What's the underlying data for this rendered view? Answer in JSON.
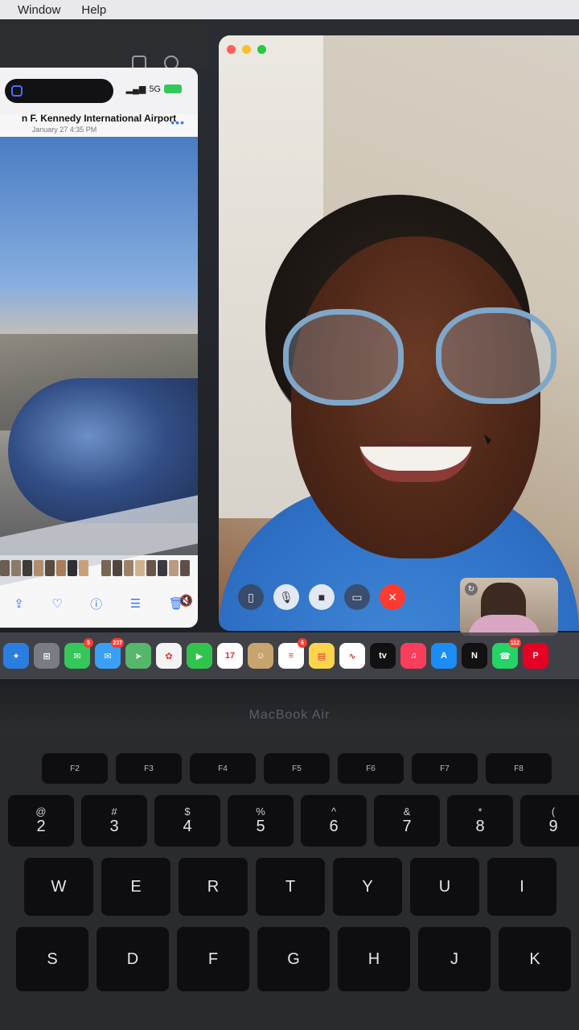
{
  "menubar": {
    "items": [
      "Window",
      "Help"
    ]
  },
  "phone_window": {
    "status": {
      "signal": "5G",
      "battery_color": "#34c759"
    },
    "photo_title": "n F. Kennedy International Airport",
    "photo_date": "January 27  4:35 PM",
    "more_icon": "ellipsis-icon",
    "tools": [
      "share-icon",
      "heart-icon",
      "info-icon",
      "adjust-icon",
      "trash-icon"
    ]
  },
  "facetime": {
    "controls": [
      "sidebar-icon",
      "mic-icon",
      "video-icon",
      "share-screen-icon",
      "end-call-icon"
    ],
    "end_color": "#ff3b30"
  },
  "dock": {
    "apps": [
      {
        "name": "safari",
        "color": "#2a7de1",
        "glyph": "✦",
        "badge": ""
      },
      {
        "name": "launchpad",
        "color": "#7a7c85",
        "glyph": "⊞",
        "badge": ""
      },
      {
        "name": "messages",
        "color": "#34c759",
        "glyph": "✉",
        "badge": "5"
      },
      {
        "name": "mail",
        "color": "#3aa0f5",
        "glyph": "✉",
        "badge": "237"
      },
      {
        "name": "maps",
        "color": "#56b66a",
        "glyph": "➤",
        "badge": ""
      },
      {
        "name": "photos",
        "color": "#f3f3f3",
        "glyph": "✿",
        "badge": ""
      },
      {
        "name": "facetime",
        "color": "#31c44d",
        "glyph": "▶",
        "badge": ""
      },
      {
        "name": "calendar",
        "color": "#ffffff",
        "glyph": "17",
        "badge": ""
      },
      {
        "name": "contacts",
        "color": "#c7a46e",
        "glyph": "☺",
        "badge": ""
      },
      {
        "name": "reminders",
        "color": "#ffffff",
        "glyph": "≡",
        "badge": "6"
      },
      {
        "name": "notes",
        "color": "#fcd54a",
        "glyph": "▤",
        "badge": ""
      },
      {
        "name": "freeform",
        "color": "#ffffff",
        "glyph": "∿",
        "badge": ""
      },
      {
        "name": "tv",
        "color": "#111111",
        "glyph": "tv",
        "badge": ""
      },
      {
        "name": "music",
        "color": "#fa3d5a",
        "glyph": "♫",
        "badge": ""
      },
      {
        "name": "app-store",
        "color": "#1b8df5",
        "glyph": "A",
        "badge": ""
      },
      {
        "name": "netflix",
        "color": "#111111",
        "glyph": "N",
        "badge": ""
      },
      {
        "name": "whatsapp",
        "color": "#25d366",
        "glyph": "☎",
        "badge": "112"
      },
      {
        "name": "pinterest",
        "color": "#e60023",
        "glyph": "P",
        "badge": ""
      }
    ]
  },
  "laptop": {
    "model": "MacBook Air"
  },
  "keys": {
    "fn_row": [
      "F2",
      "F3",
      "F4",
      "F5",
      "F6",
      "F7",
      "F8"
    ],
    "num_row": [
      {
        "top": "@",
        "main": "2"
      },
      {
        "top": "#",
        "main": "3"
      },
      {
        "top": "$",
        "main": "4"
      },
      {
        "top": "%",
        "main": "5"
      },
      {
        "top": "^",
        "main": "6"
      },
      {
        "top": "&",
        "main": "7"
      },
      {
        "top": "*",
        "main": "8"
      },
      {
        "top": "(",
        "main": "9"
      }
    ],
    "row_q": [
      "W",
      "E",
      "R",
      "T",
      "Y",
      "U",
      "I"
    ],
    "row_a": [
      "S",
      "D",
      "F",
      "G",
      "H",
      "J",
      "K"
    ]
  }
}
